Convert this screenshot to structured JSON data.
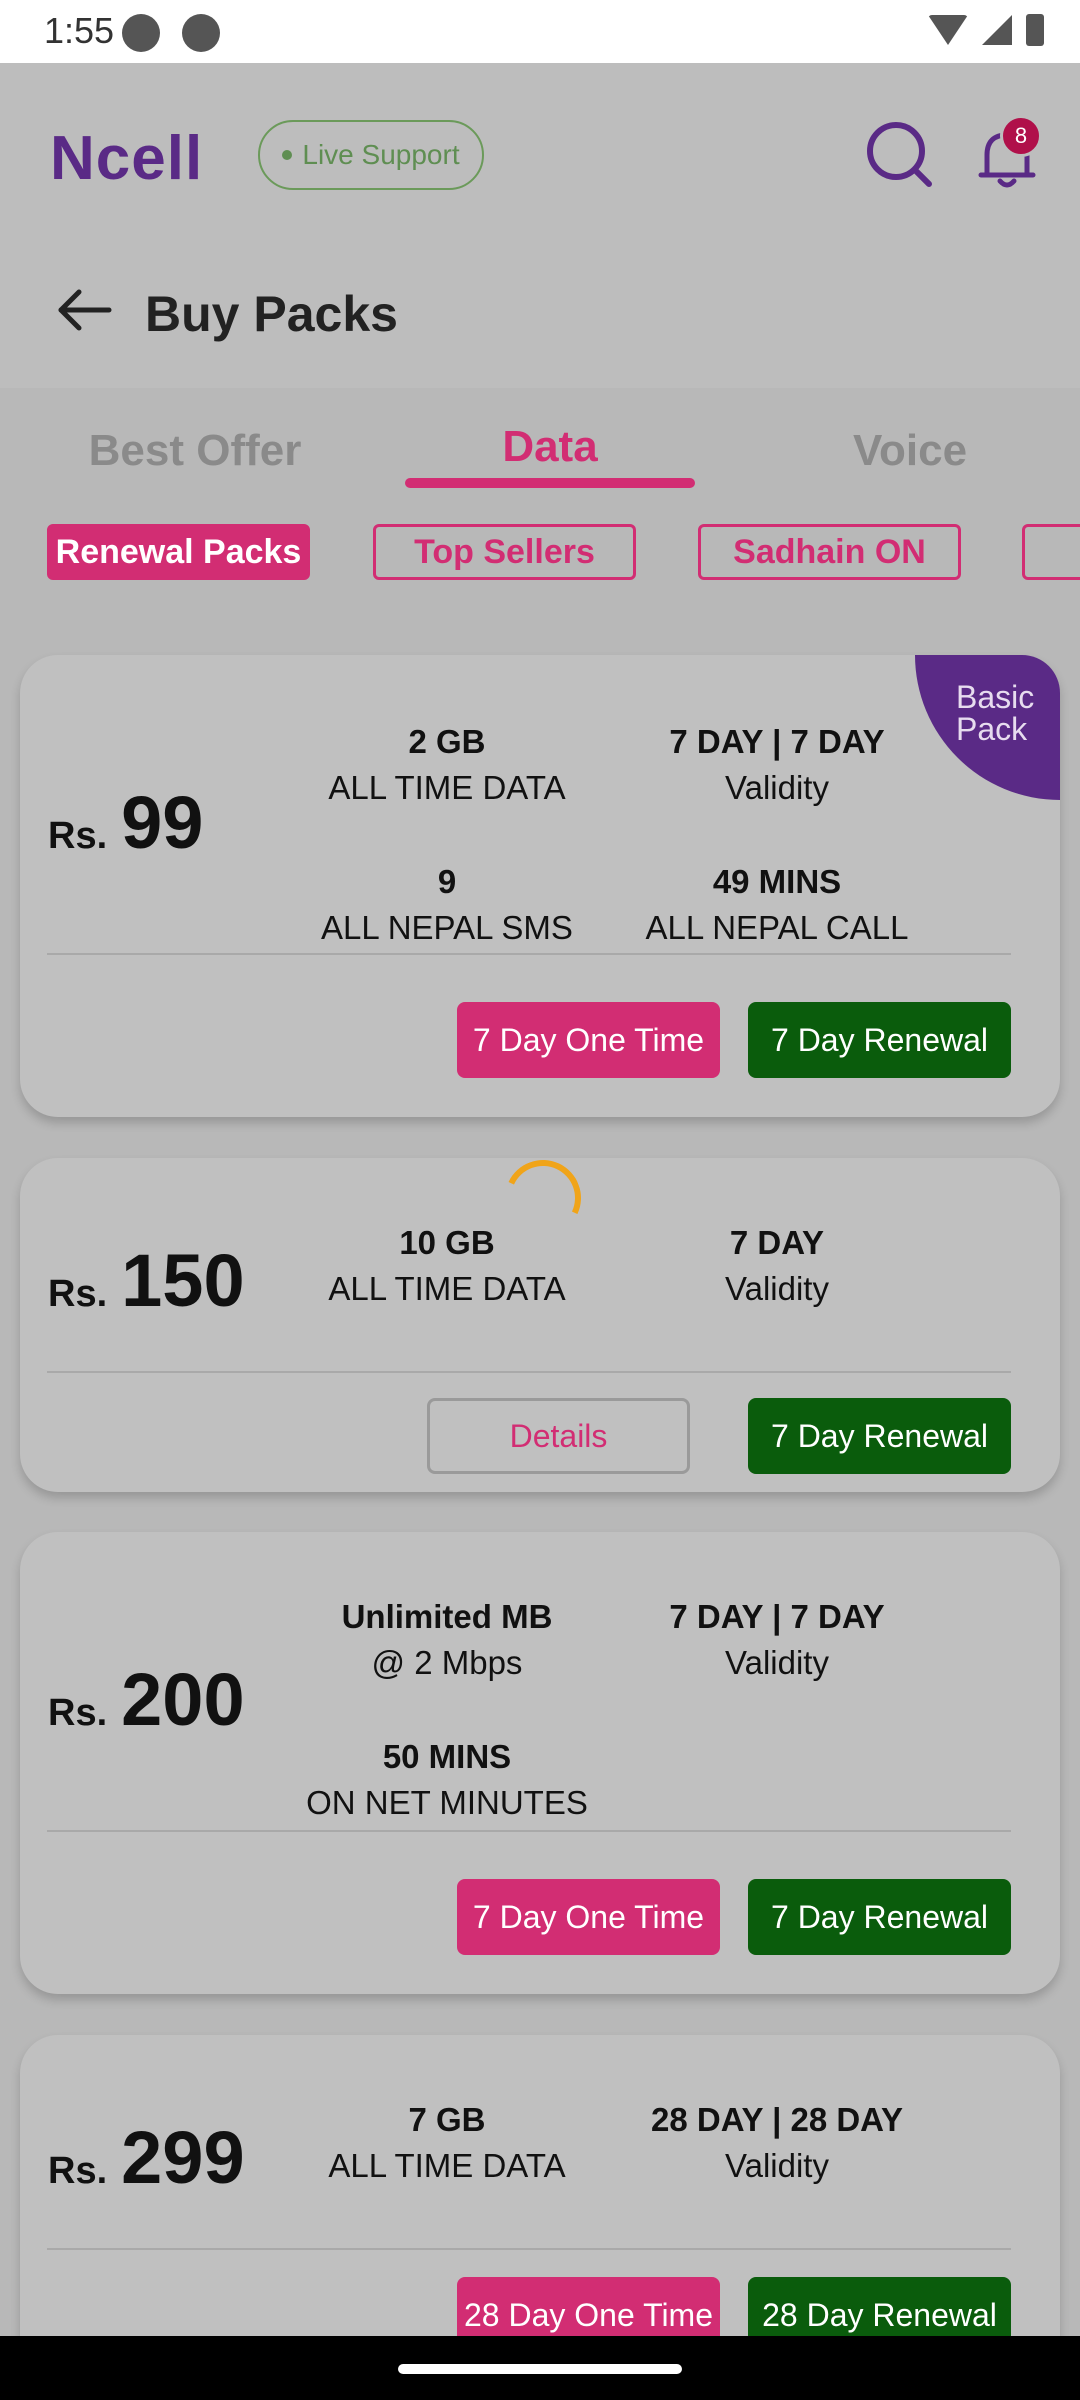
{
  "status_bar": {
    "time": "1:55"
  },
  "header": {
    "logo": "Ncell",
    "live_support": "Live Support",
    "notification_count": "8",
    "page_title": "Buy Packs"
  },
  "tabs": [
    {
      "label": "Best Offer",
      "active": false
    },
    {
      "label": "Data",
      "active": true
    },
    {
      "label": "Voice",
      "active": false
    }
  ],
  "chips": [
    {
      "label": "Renewal Packs",
      "active": true
    },
    {
      "label": "Top Sellers",
      "active": false
    },
    {
      "label": "Sadhain ON",
      "active": false
    }
  ],
  "cards": [
    {
      "currency": "Rs.",
      "price": "99",
      "corner_badge": "Basic Pack",
      "features": [
        {
          "value": "2 GB",
          "label": "ALL TIME DATA"
        },
        {
          "value": "7 DAY | 7 DAY",
          "label": "Validity"
        },
        {
          "value": "9",
          "label": "ALL NEPAL SMS"
        },
        {
          "value": "49 MINS",
          "label": "ALL NEPAL CALL"
        }
      ],
      "buttons": [
        "7 Day One Time",
        "7 Day Renewal"
      ]
    },
    {
      "currency": "Rs.",
      "price": "150",
      "features": [
        {
          "value": "10 GB",
          "label": "ALL TIME DATA"
        },
        {
          "value": "7 DAY",
          "label": "Validity"
        }
      ],
      "buttons": [
        "Details",
        "7 Day Renewal"
      ]
    },
    {
      "currency": "Rs.",
      "price": "200",
      "features": [
        {
          "value": "Unlimited MB",
          "label": "@ 2 Mbps"
        },
        {
          "value": "7 DAY | 7 DAY",
          "label": "Validity"
        },
        {
          "value": "50 MINS",
          "label": "ON NET MINUTES"
        }
      ],
      "buttons": [
        "7 Day One Time",
        "7 Day Renewal"
      ]
    },
    {
      "currency": "Rs.",
      "price": "299",
      "features": [
        {
          "value": "7 GB",
          "label": "ALL TIME DATA"
        },
        {
          "value": "28 DAY | 28 DAY",
          "label": "Validity"
        }
      ],
      "buttons": [
        "28 Day One Time",
        "28 Day Renewal"
      ]
    }
  ],
  "colors": {
    "brand_purple": "#5a2a86",
    "accent_pink": "#d22d73",
    "renewal_green": "#0a5c0c",
    "live_green": "#5f8e52"
  }
}
